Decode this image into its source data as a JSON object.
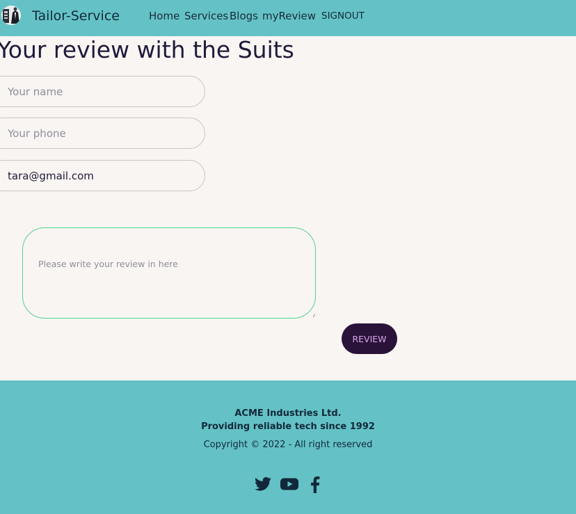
{
  "header": {
    "brand": "Tailor-Service",
    "logo_icon": "suit-logo-icon",
    "nav": [
      {
        "label": "Home"
      },
      {
        "label": "Services"
      },
      {
        "label": "Blogs"
      },
      {
        "label": "myReview"
      }
    ],
    "signout_label": "SIGNOUT"
  },
  "form": {
    "title": "Your review with the Suits",
    "name_placeholder": "Your name",
    "phone_placeholder": "Your phone",
    "email_value": "tara@gmail.com",
    "review_placeholder": "Please write your review in here",
    "submit_label": "REVIEW"
  },
  "footer": {
    "company": "ACME Industries Ltd.",
    "tagline": "Providing reliable tech since 1992",
    "copyright": "Copyright © 2022 - All right reserved",
    "social_icons": [
      "twitter-icon",
      "youtube-icon",
      "facebook-icon"
    ]
  },
  "colors": {
    "header_bg": "#64c2c6",
    "footer_bg": "#64c2c6",
    "page_bg": "#f9f5f3",
    "button_bg": "#2a1339",
    "button_text": "#d9a6ea",
    "review_border": "#54d28c"
  }
}
